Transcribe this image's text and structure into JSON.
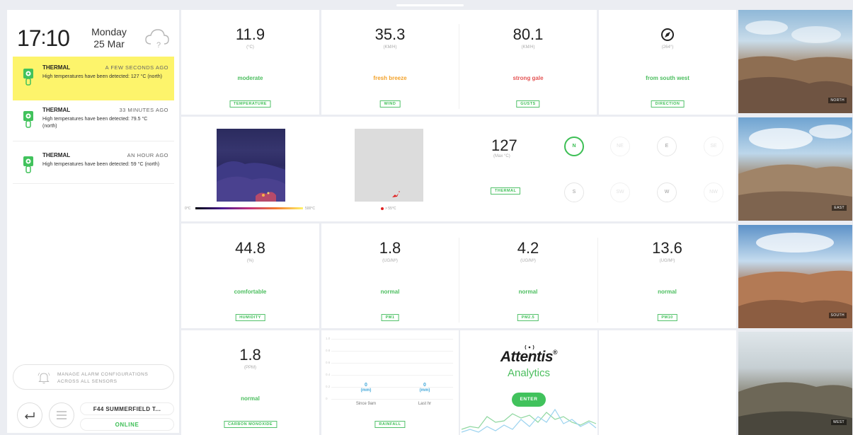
{
  "clock": {
    "hours": "17",
    "minutes": "10",
    "day": "Monday",
    "date": "25 Mar"
  },
  "alerts": [
    {
      "title": "THERMAL",
      "time": "A FEW SECONDS AGO",
      "message": "High temperatures have been detected: 127 °C (north)"
    },
    {
      "title": "THERMAL",
      "time": "33 MINUTES AGO",
      "message": "High temperatures have been detected: 79.5 °C (north)"
    },
    {
      "title": "THERMAL",
      "time": "AN HOUR AGO",
      "message": "High temperatures have been detected: 59 °C (north)"
    }
  ],
  "sidebar": {
    "manage_label": "MANAGE ALARM CONFIGURATIONS ACROSS ALL SENSORS",
    "device_name": "F44 SUMMERFIELD T...",
    "device_status": "ONLINE"
  },
  "weather": {
    "temperature": {
      "value": "11.9",
      "unit": "(°C)",
      "desc": "moderate",
      "tag": "TEMPERATURE"
    },
    "wind": {
      "value": "35.3",
      "unit": "(KM/H)",
      "desc": "fresh breeze",
      "tag": "WIND"
    },
    "gusts": {
      "value": "80.1",
      "unit": "(KM/H)",
      "desc": "strong gale",
      "tag": "GUSTS"
    },
    "direction": {
      "unit": "(264°)",
      "desc": "from south west",
      "tag": "DIRECTION"
    }
  },
  "thermal": {
    "legend_min": "0°C",
    "legend_max": "500°C",
    "detect_legend": "> 55°C",
    "max_value": "127",
    "max_unit": "(Max °C)",
    "tag": "THERMAL",
    "directions": [
      "N",
      "NE",
      "E",
      "SE",
      "S",
      "SW",
      "W",
      "NW"
    ],
    "active_direction": "N"
  },
  "air": {
    "humidity": {
      "value": "44.8",
      "unit": "(%)",
      "desc": "comfortable",
      "tag": "HUMIDITY"
    },
    "pm1": {
      "value": "1.8",
      "unit": "(UG/M³)",
      "desc": "normal",
      "tag": "PM1"
    },
    "pm25": {
      "value": "4.2",
      "unit": "(UG/M³)",
      "desc": "normal",
      "tag": "PM2.5"
    },
    "pm10": {
      "value": "13.6",
      "unit": "(UG/M³)",
      "desc": "normal",
      "tag": "PM10"
    },
    "co": {
      "value": "1.8",
      "unit": "(PPM)",
      "desc": "normal",
      "tag": "CARBON MONOXIDE"
    }
  },
  "rainfall": {
    "ticks": [
      "1.0",
      "0.8",
      "0.6",
      "0.4",
      "0.2",
      "0"
    ],
    "since9_value": "0",
    "since9_unit": "(mm)",
    "since9_label": "Since 9am",
    "lasthr_value": "0",
    "lasthr_unit": "(mm)",
    "lasthr_label": "Last hr",
    "tag": "RAINFALL"
  },
  "brand": {
    "name": "Attentis",
    "reg": "®",
    "sub": "Analytics",
    "enter": "ENTER"
  },
  "cameras": [
    {
      "label": "NORTH"
    },
    {
      "label": "EAST"
    },
    {
      "label": "SOUTH"
    },
    {
      "label": "WEST"
    }
  ],
  "colors": {
    "accent": "#41c25c",
    "warning": "#f3a22a",
    "danger": "#e45454",
    "alert_bg": "#fdf46b",
    "rain": "#3fa6d8"
  }
}
